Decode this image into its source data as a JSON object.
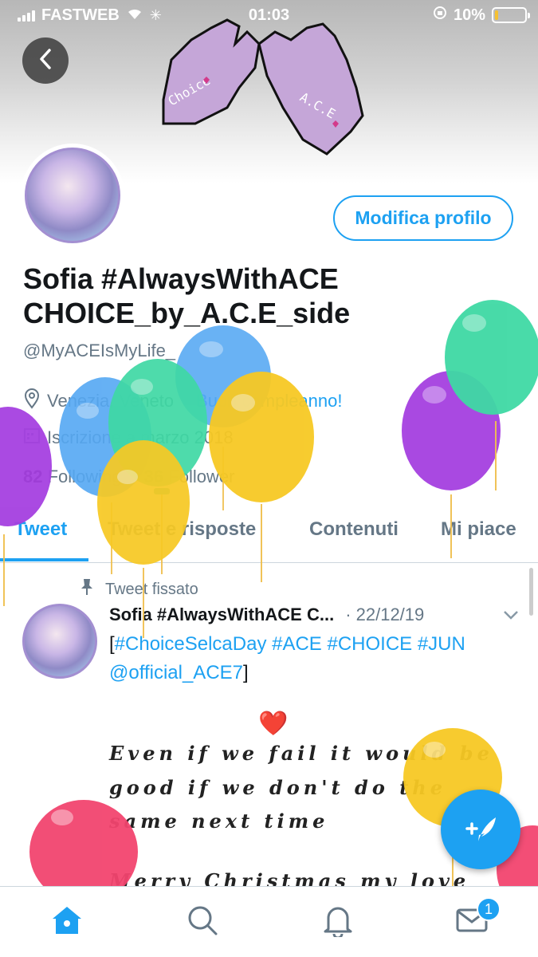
{
  "status_bar": {
    "carrier": "FASTWEB",
    "time": "01:03",
    "battery_percent": "10%",
    "battery_level": 0.1
  },
  "profile": {
    "back_icon": "chevron-left-icon",
    "edit_label": "Modifica profilo",
    "name_line1": "Sofia #AlwaysWithACE",
    "name_line2": "CHOICE_by_A.C.E_side",
    "handle": "@MyACEIsMyLife_",
    "location": "Venezia, Veneto",
    "birthday_text": "Buon compleanno!",
    "joined": "Iscrizione a marzo 2018",
    "following_count": "82",
    "following_label": "Following",
    "followers_count": "36",
    "followers_label": "Follower",
    "banner_labels": [
      "Choice",
      "A.C.E"
    ]
  },
  "tabs": [
    {
      "label": "Tweet",
      "active": true
    },
    {
      "label": "Tweet e risposte",
      "active": false
    },
    {
      "label": "Contenuti",
      "active": false
    },
    {
      "label": "Mi piace",
      "active": false
    }
  ],
  "pinned_tweet": {
    "pinned_label": "Tweet fissato",
    "author": "Sofia #AlwaysWithACE C...",
    "date": "· 22/12/19",
    "text_open": "[",
    "hashtags": "#ChoiceSelcaDay #ACE #CHOICE #JUN",
    "mention": "@official_ACE7",
    "text_close": "]",
    "heart": "❤️",
    "script_line1": "Even if we fail it would be",
    "script_line2": "good if we don't do the",
    "script_line3": "same next time",
    "script_line4": "Merry Christmas my love"
  },
  "tab_bar": {
    "icons": [
      "home-icon",
      "search-icon",
      "bell-icon",
      "mail-icon"
    ],
    "mail_badge": "1"
  },
  "colors": {
    "accent": "#1da1f2",
    "secondary_text": "#657786",
    "balloon_purple": "#a540e0",
    "balloon_blue": "#55a8f3",
    "balloon_green": "#3fd9a4",
    "balloon_yellow": "#f7c924",
    "balloon_pink": "#f2456f"
  }
}
